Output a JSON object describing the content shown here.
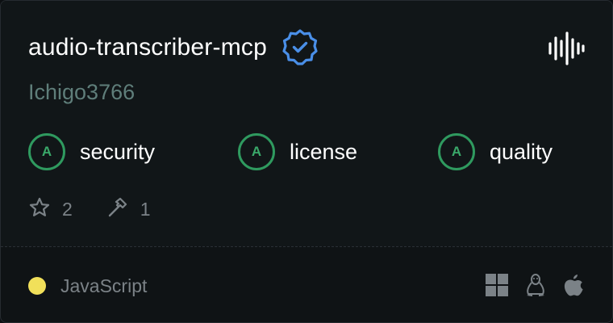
{
  "card": {
    "title": "audio-transcriber-mcp",
    "author": "Ichigo3766",
    "verified_icon": "verified-badge-icon",
    "category_icon": "audio-waveform-icon"
  },
  "grades": [
    {
      "grade": "A",
      "label": "security"
    },
    {
      "grade": "A",
      "label": "license"
    },
    {
      "grade": "A",
      "label": "quality"
    }
  ],
  "stats": {
    "stars": "2",
    "tools": "1"
  },
  "footer": {
    "language": "JavaScript",
    "platforms": [
      "windows-icon",
      "linux-icon",
      "apple-icon"
    ]
  },
  "colors": {
    "background": "#0f1315",
    "grade_green": "#2f9a5f",
    "verified_blue": "#4a8fe8",
    "language_dot": "#f1e05a",
    "muted_text": "#7b8287",
    "author_text": "#5f7e7a"
  }
}
